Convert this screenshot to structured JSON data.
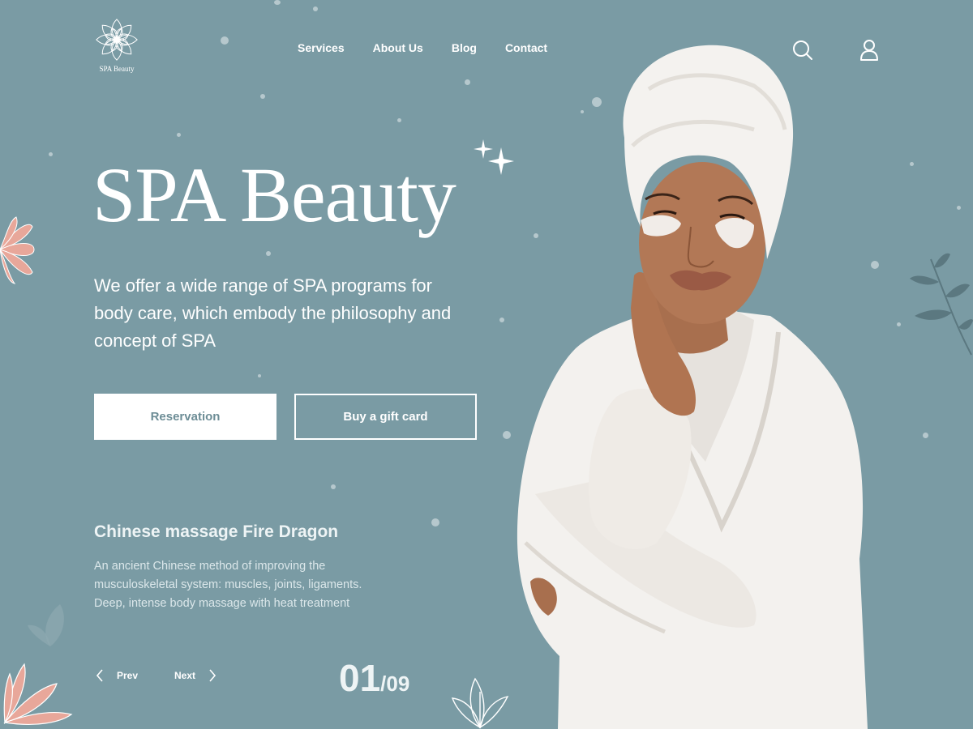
{
  "brand": {
    "name": "SPA Beauty"
  },
  "nav": {
    "items": [
      {
        "label": "Services"
      },
      {
        "label": "About Us"
      },
      {
        "label": "Blog"
      },
      {
        "label": "Contact"
      }
    ]
  },
  "header_icons": [
    "search-icon",
    "user-icon"
  ],
  "hero": {
    "title": "SPA Beauty",
    "description": "We offer a wide range of SPA programs for body care, which embody the philosophy and concept of SPA",
    "primary_button": "Reservation",
    "secondary_button": "Buy a gift card"
  },
  "feature": {
    "title": "Chinese massage Fire Dragon",
    "description": "An ancient Chinese method of improving the musculoskeletal system: muscles, joints, ligaments. Deep, intense body massage with heat treatment"
  },
  "pager": {
    "prev_label": "Prev",
    "next_label": "Next",
    "current": "01",
    "total": "/09"
  },
  "colors": {
    "background": "#7a9ba4",
    "text": "#ffffff",
    "button_text": "#6d8d96",
    "accent_flower": "#e8a79a"
  }
}
